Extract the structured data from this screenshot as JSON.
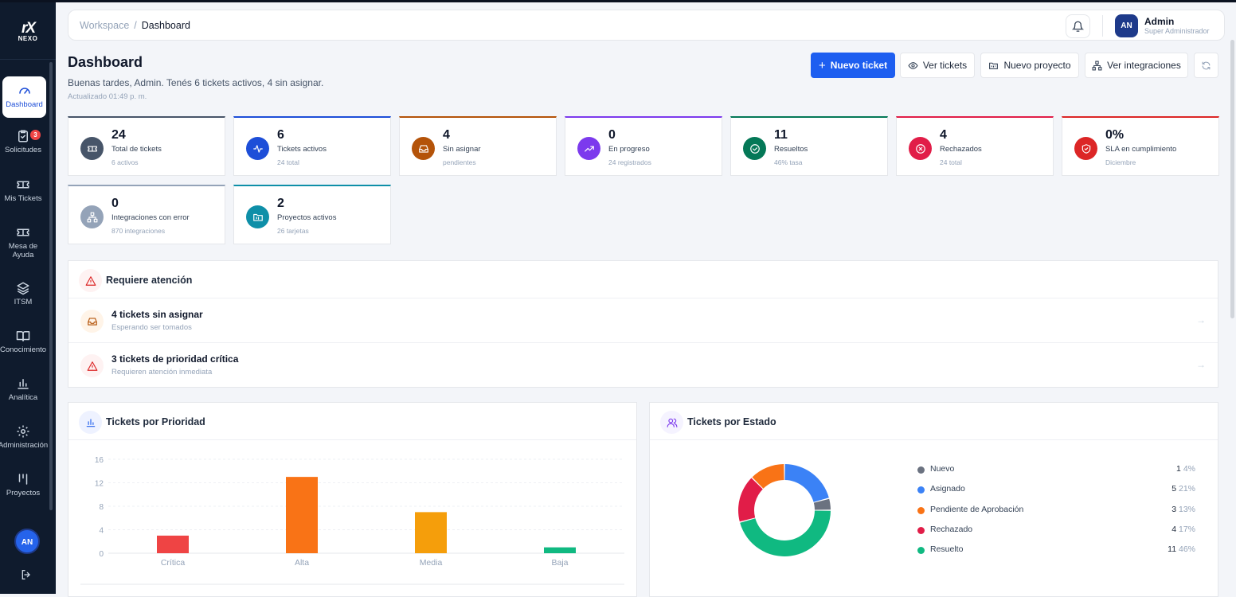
{
  "app": {
    "logo_mark": "rX",
    "logo_name": "NEXO"
  },
  "sidebar": {
    "items": [
      {
        "label": "Dashboard",
        "icon": "gauge-icon",
        "active": true
      },
      {
        "label": "Solicitudes",
        "icon": "clipboard-check-icon",
        "badge": "3"
      },
      {
        "label": "Mis Tickets",
        "icon": "ticket-icon"
      },
      {
        "label": "Mesa de Ayuda",
        "icon": "ticket-icon"
      },
      {
        "label": "ITSM",
        "icon": "layers-icon"
      },
      {
        "label": "Conocimiento",
        "icon": "book-open-icon"
      },
      {
        "label": "Analítica",
        "icon": "bar-chart-icon"
      },
      {
        "label": "Administración",
        "icon": "gear-icon"
      },
      {
        "label": "Proyectos",
        "icon": "kanban-icon"
      }
    ],
    "avatar": "AN"
  },
  "topbar": {
    "breadcrumb_root": "Workspace",
    "breadcrumb_sep": "/",
    "breadcrumb_current": "Dashboard",
    "avatar": "AN",
    "user_name": "Admin",
    "user_role": "Super Administrador"
  },
  "header": {
    "title": "Dashboard",
    "subtitle": "Buenas tardes, Admin. Tenés 6 tickets activos, 4 sin asignar.",
    "updated": "Actualizado 01:49 p. m.",
    "buttons": {
      "new_ticket": "Nuevo ticket",
      "view_tickets": "Ver tickets",
      "new_project": "Nuevo proyecto",
      "view_integrations": "Ver integraciones"
    }
  },
  "stats": [
    {
      "value": "24",
      "label": "Total de tickets",
      "sub": "6 activos",
      "color": "#475569",
      "icon": "ticket-icon"
    },
    {
      "value": "6",
      "label": "Tickets activos",
      "sub": "24 total",
      "color": "#1d4ed8",
      "icon": "activity-icon"
    },
    {
      "value": "4",
      "label": "Sin asignar",
      "sub": "pendientes",
      "color": "#b45309",
      "icon": "inbox-icon"
    },
    {
      "value": "0",
      "label": "En progreso",
      "sub": "24 registrados",
      "color": "#7c3aed",
      "icon": "trending-up-icon"
    },
    {
      "value": "11",
      "label": "Resueltos",
      "sub": "46% tasa",
      "color": "#047857",
      "icon": "check-circle-icon"
    },
    {
      "value": "4",
      "label": "Rechazados",
      "sub": "24 total",
      "color": "#e11d48",
      "icon": "x-circle-icon"
    },
    {
      "value": "0%",
      "label": "SLA en cumplimiento",
      "sub": "Diciembre",
      "color": "#dc2626",
      "icon": "shield-icon"
    },
    {
      "value": "0",
      "label": "Integraciones con error",
      "sub": "870 integraciones",
      "color": "#94a3b8",
      "icon": "network-icon"
    },
    {
      "value": "2",
      "label": "Proyectos activos",
      "sub": "26 tarjetas",
      "color": "#0e8fa8",
      "icon": "folder-icon"
    }
  ],
  "attention": {
    "title": "Requiere atención",
    "items": [
      {
        "title": "4 tickets sin asignar",
        "sub": "Esperando ser tomados",
        "color": "#b45309",
        "icon": "inbox-icon"
      },
      {
        "title": "3 tickets de prioridad crítica",
        "sub": "Requieren atención inmediata",
        "color": "#dc2626",
        "icon": "alert-triangle-icon"
      }
    ]
  },
  "priority_panel": {
    "title": "Tickets por Prioridad"
  },
  "status_panel": {
    "title": "Tickets por Estado"
  },
  "chart_data": [
    {
      "type": "bar",
      "title": "Tickets por Prioridad",
      "categories": [
        "Crítica",
        "Alta",
        "Media",
        "Baja"
      ],
      "values": [
        3,
        13,
        7,
        1
      ],
      "colors": [
        "#ef4444",
        "#f97316",
        "#f59e0b",
        "#10b981"
      ],
      "yticks": [
        0,
        4,
        8,
        12,
        16
      ],
      "ylim": [
        0,
        16
      ],
      "grid": true
    },
    {
      "type": "pie",
      "title": "Tickets por Estado",
      "labels": [
        "Nuevo",
        "Asignado",
        "Pendiente de Aprobación",
        "Rechazado",
        "Resuelto"
      ],
      "values": [
        1,
        5,
        3,
        4,
        11
      ],
      "percents": [
        "4%",
        "21%",
        "13%",
        "17%",
        "46%"
      ],
      "colors": [
        "#6b7280",
        "#3b82f6",
        "#f97316",
        "#e11d48",
        "#10b981"
      ],
      "legend": "right"
    }
  ]
}
